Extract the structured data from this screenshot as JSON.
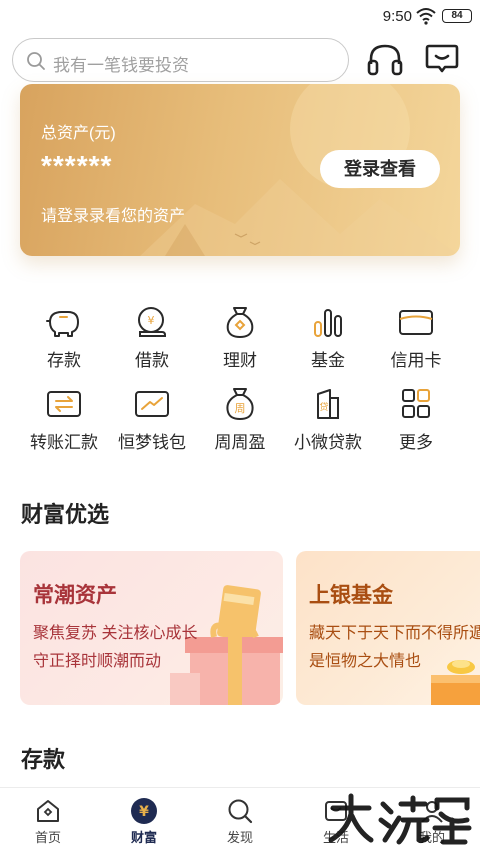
{
  "status_bar": {
    "time": "9:50",
    "battery": "84"
  },
  "header": {
    "search_placeholder": "我有一笔钱要投资"
  },
  "asset_card": {
    "label": "总资产(元)",
    "value": "******",
    "hint": "请登录录看您的资产",
    "login_button": "登录查看"
  },
  "services": [
    {
      "label": "存款",
      "icon": "piggy-bank-icon"
    },
    {
      "label": "借款",
      "icon": "loan-icon"
    },
    {
      "label": "理财",
      "icon": "money-bag-icon"
    },
    {
      "label": "基金",
      "icon": "bar-chart-icon"
    },
    {
      "label": "信用卡",
      "icon": "credit-card-icon"
    },
    {
      "label": "转账汇款",
      "icon": "transfer-icon"
    },
    {
      "label": "恒梦钱包",
      "icon": "wallet-trend-icon"
    },
    {
      "label": "周周盈",
      "icon": "weekly-bag-icon"
    },
    {
      "label": "小微贷款",
      "icon": "micro-loan-icon"
    },
    {
      "label": "更多",
      "icon": "grid-more-icon"
    }
  ],
  "wealth_section": {
    "title": "财富优选",
    "cards": [
      {
        "name": "常潮资产",
        "line1": "聚焦复苏 关注核心成长",
        "line2": "守正择时顺潮而动"
      },
      {
        "name": "上银基金",
        "line1": "藏天下于天下而不得所遁",
        "line2": "是恒物之大情也"
      }
    ]
  },
  "deposit_section": {
    "title": "存款"
  },
  "tab_bar": {
    "items": [
      {
        "label": "首页",
        "icon": "home-icon"
      },
      {
        "label": "财富",
        "icon": "yen-icon",
        "active": true
      },
      {
        "label": "发现",
        "icon": "discover-icon"
      },
      {
        "label": "生活",
        "icon": "life-icon"
      },
      {
        "label": "我的",
        "icon": "profile-icon"
      }
    ]
  },
  "colors": {
    "accent": "#1f2b52",
    "gold": "#d8a35e",
    "pink_text": "#a8343a",
    "orange_text": "#a94e12"
  }
}
